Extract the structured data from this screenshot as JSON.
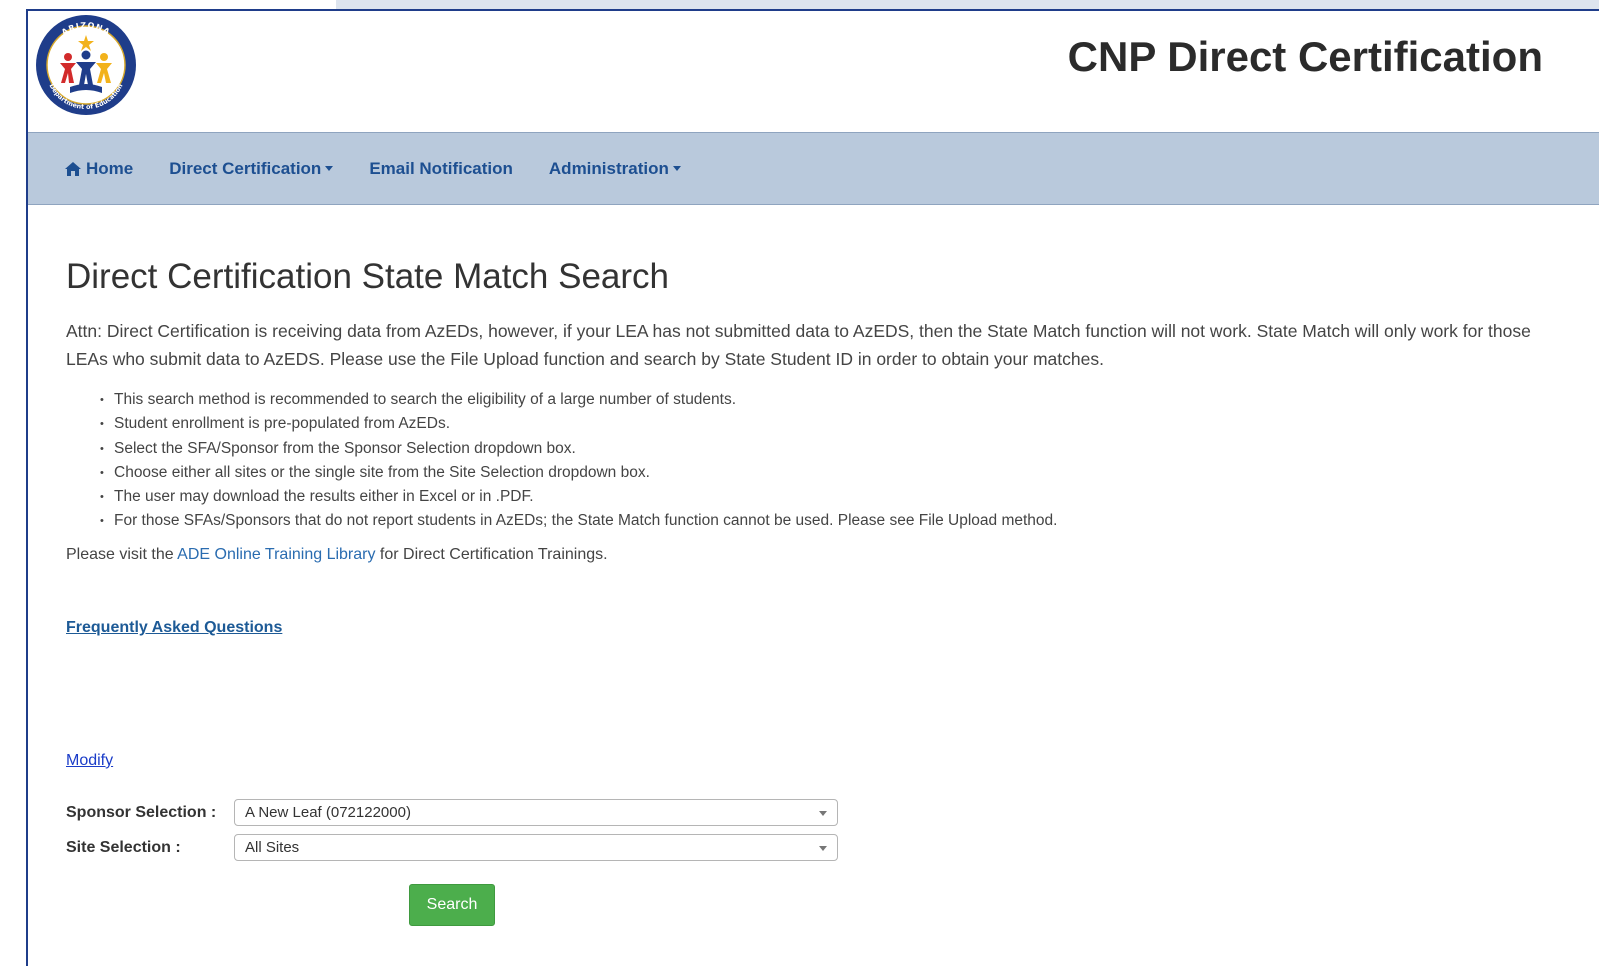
{
  "header": {
    "app_title": "CNP Direct Certification",
    "logo_top_text": "ARIZONA",
    "logo_bottom_text": "Department of Education"
  },
  "nav": {
    "home": "Home",
    "direct_certification": "Direct Certification",
    "email_notification": "Email Notification",
    "administration": "Administration"
  },
  "page": {
    "title": "Direct Certification State Match Search",
    "attn": "Attn: Direct Certification is receiving data from AzEDs, however, if your LEA has not submitted data to AzEDS, then the State Match function will not work. State Match will only work for those LEAs who submit data to AzEDS. Please use the File Upload function and search by State Student ID in order to obtain your matches.",
    "bullets": [
      "This search method is recommended to search the eligibility of a large number of students.",
      "Student enrollment is pre-populated from AzEDs.",
      "Select the SFA/Sponsor from the Sponsor Selection dropdown box.",
      "Choose either all sites or the single site from the Site Selection dropdown box.",
      "The user may download the results either in Excel or in .PDF.",
      "For those SFAs/Sponsors that do not report students in AzEDs; the State Match function cannot be used. Please see File Upload method."
    ],
    "visit_prefix": "Please visit the ",
    "visit_link": "ADE Online Training Library",
    "visit_suffix": " for Direct Certification Trainings.",
    "faq_link": "Frequently Asked Questions",
    "modify_link": "Modify"
  },
  "form": {
    "sponsor_label": "Sponsor Selection :",
    "sponsor_value": "A New Leaf (072122000)",
    "site_label": "Site Selection :",
    "site_value": "All Sites",
    "search_button": "Search"
  },
  "colors": {
    "navbar_bg": "#b9c9dc",
    "nav_link": "#1d4f91",
    "search_button": "#4cae4c",
    "frame_border": "#1f3d8a"
  }
}
